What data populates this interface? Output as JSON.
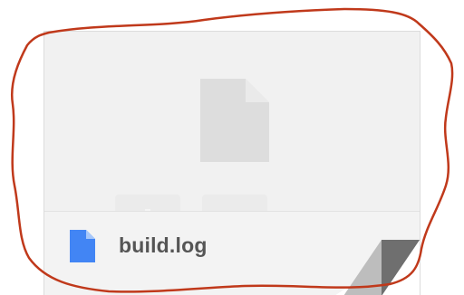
{
  "file": {
    "name": "build.log",
    "icon": "file-icon",
    "icon_color": "#4285f4"
  },
  "preview": {
    "icon": "file-icon",
    "icon_color": "#dddddd"
  },
  "actions": [
    {
      "icon": "download-icon"
    },
    {
      "icon": "google-drive-icon"
    }
  ],
  "annotation": {
    "shape": "freehand-circle",
    "color": "#c0391b"
  },
  "colors": {
    "card_background": "#f1f1f1",
    "footer_background": "#f3f3f3",
    "filename_text": "#555555"
  }
}
